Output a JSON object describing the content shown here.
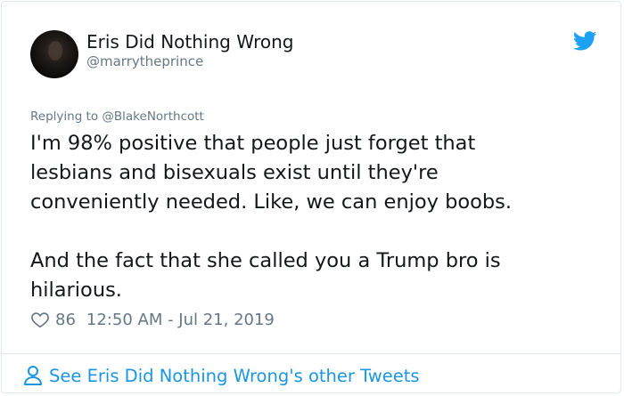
{
  "author": {
    "display_name": "Eris Did Nothing Wrong",
    "handle": "@marrytheprince"
  },
  "reply": {
    "prefix": "Replying to",
    "handle": "@BlakeNorthcott",
    "full": "Replying to @BlakeNorthcott"
  },
  "tweet": {
    "lines": [
      "I'm 98% positive that people just forget that",
      "lesbians and bisexuals exist until they're",
      "conveniently needed. Like, we can enjoy boobs.",
      "And the fact that she called you a Trump bro is",
      "hilarious."
    ]
  },
  "meta": {
    "like_count": "86",
    "timestamp": "12:50 AM - Jul 21, 2019"
  },
  "footer": {
    "link_text": "See Eris Did Nothing Wrong's other Tweets"
  },
  "colors": {
    "brand_blue": "#1b95e0",
    "twitter_blue": "#1da1f2",
    "muted": "#657786",
    "text": "#14171a",
    "border": "#e1e8ed"
  },
  "icons": {
    "brand": "twitter-bird-icon",
    "like": "heart-icon",
    "profile": "person-icon"
  }
}
